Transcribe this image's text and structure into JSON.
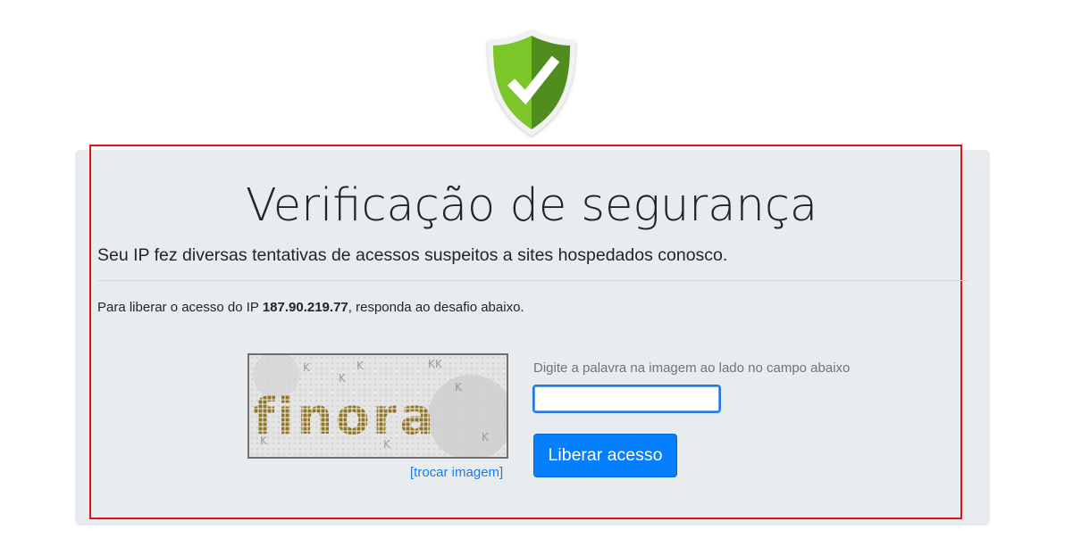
{
  "header": {
    "icon": "shield-check-icon",
    "colors": {
      "shield_light": "#7cc62a",
      "shield_dark": "#4e8d1e",
      "check": "#ffffff"
    }
  },
  "main": {
    "title": "Verificação de segurança",
    "lead": "Seu IP fez diversas tentativas de acessos suspeitos a sites hospedados conosco.",
    "instruction": {
      "prefix": "Para liberar o acesso do IP ",
      "ip": "187.90.219.77",
      "suffix": ", responda ao desafio abaixo."
    },
    "captcha": {
      "word": "finora",
      "swap_link": "[trocar imagem]"
    },
    "form": {
      "label": "Digite a palavra na imagem ao lado no campo abaixo",
      "input_value": "",
      "input_placeholder": "",
      "submit_label": "Liberar acesso"
    }
  },
  "colors": {
    "panel_bg": "#e9ecef",
    "highlight_border": "#e0141b",
    "primary": "#057ffe",
    "link": "#1a7de8"
  }
}
